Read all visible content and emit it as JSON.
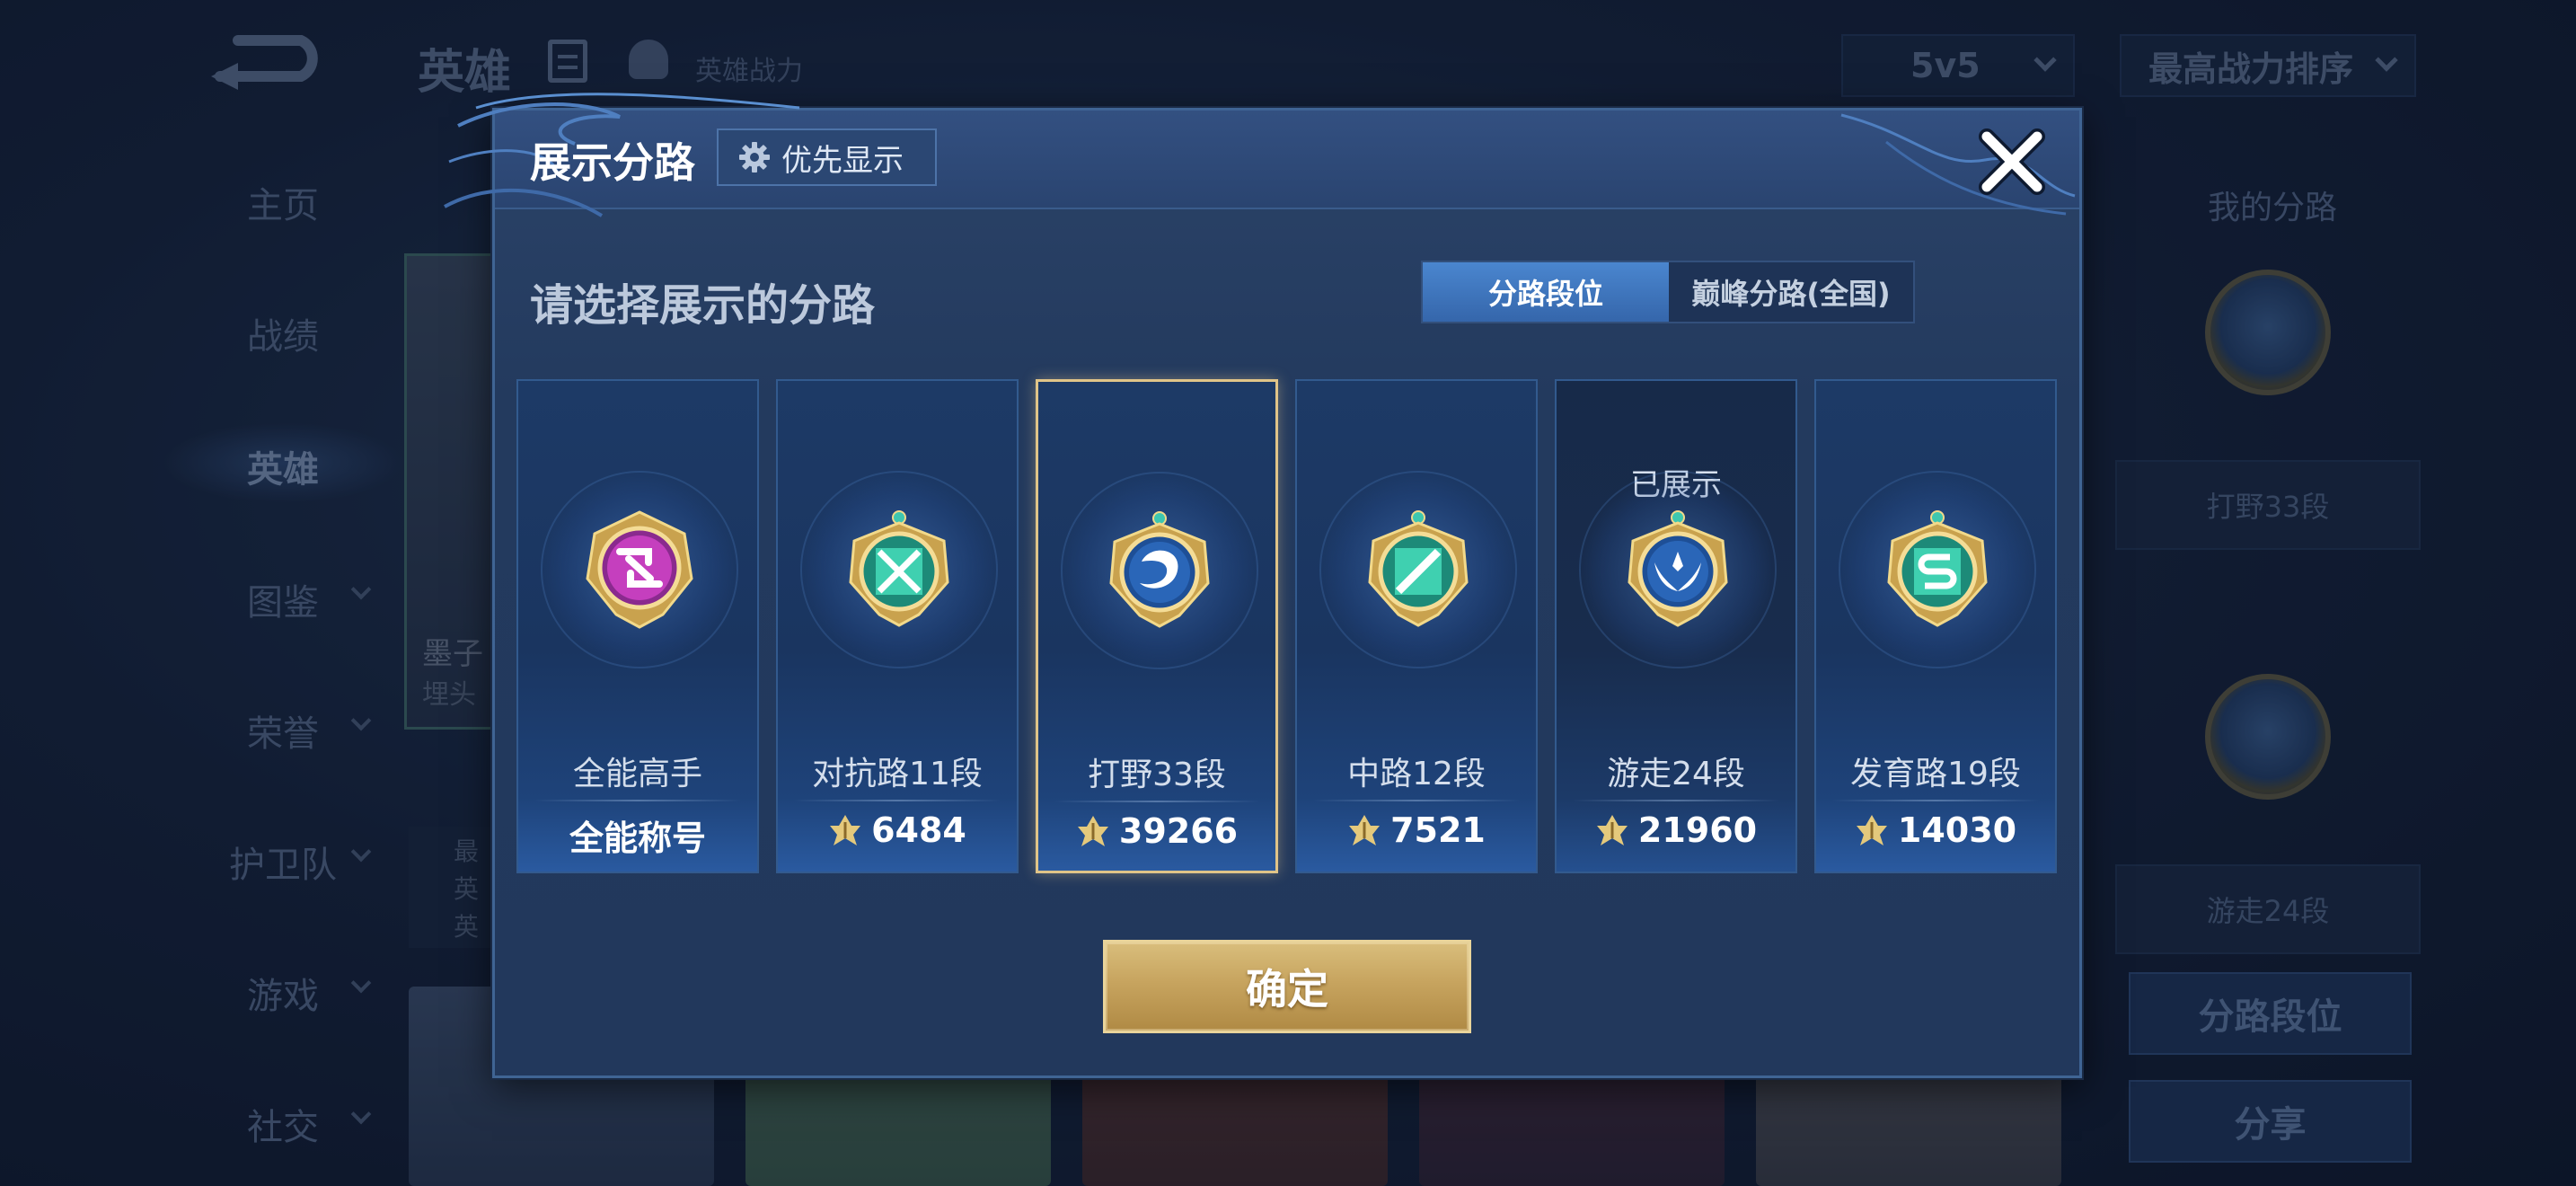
{
  "background": {
    "header_title": "英雄",
    "power_label": "英雄战力",
    "mode_select": "5v5",
    "sort_select": "最高战力排序",
    "sidebar": [
      {
        "label": "主页"
      },
      {
        "label": "战绩"
      },
      {
        "label": "英雄",
        "active": true
      },
      {
        "label": "图鉴"
      },
      {
        "label": "荣誉"
      },
      {
        "label": "护卫队"
      },
      {
        "label": "游戏"
      },
      {
        "label": "社交"
      }
    ],
    "hero_name": "墨子",
    "hero_sub": "埋头",
    "hero_info": [
      "最",
      "英",
      "英"
    ],
    "right": {
      "title": "我的分路",
      "lane_1": "打野33段",
      "lane_2": "游走24段",
      "btn_lane_rank": "分路段位",
      "btn_share": "分享"
    }
  },
  "modal": {
    "title": "展示分路",
    "priority_button": "优先显示",
    "subtitle": "请选择展示的分路",
    "segments": [
      "分路段位",
      "巅峰分路(全国)"
    ],
    "active_segment": 0,
    "lanes": [
      {
        "name": "全能高手",
        "value": "全能称号",
        "has_power_icon": false,
        "emblem": "all-round-emblem",
        "color": "#c23ab8"
      },
      {
        "name": "对抗路11段",
        "value": "6484",
        "has_power_icon": true,
        "emblem": "clash-lane-emblem",
        "color": "#2fbf9c"
      },
      {
        "name": "打野33段",
        "value": "39266",
        "has_power_icon": true,
        "emblem": "jungle-emblem",
        "color": "#2a66b8",
        "selected": true
      },
      {
        "name": "中路12段",
        "value": "7521",
        "has_power_icon": true,
        "emblem": "mid-lane-emblem",
        "color": "#2fbf9c"
      },
      {
        "name": "游走24段",
        "value": "21960",
        "has_power_icon": true,
        "emblem": "roam-emblem",
        "color": "#2a66b8",
        "shown_tag": "已展示"
      },
      {
        "name": "发育路19段",
        "value": "14030",
        "has_power_icon": true,
        "emblem": "farm-lane-emblem",
        "color": "#2fbf9c"
      }
    ],
    "confirm_button": "确定"
  },
  "colors": {
    "accent_gold": "#d9be7c",
    "selected_border": "#e0c488",
    "segment_active": "#4a86cf"
  }
}
